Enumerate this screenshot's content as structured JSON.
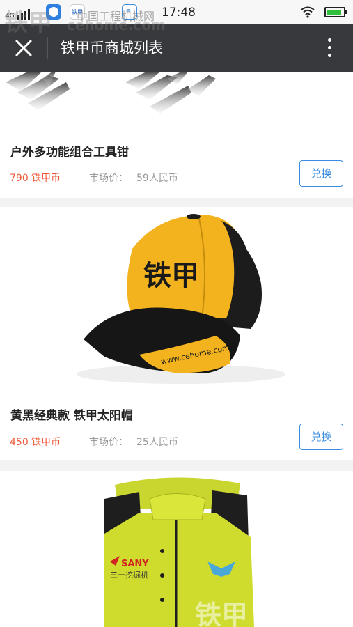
{
  "status_bar": {
    "network": "4G",
    "time": "17:48",
    "app_icon_label": "铁甲"
  },
  "watermark": {
    "brand": "铁甲",
    "site_cn": "中国工程机械网",
    "site": "cehome.com"
  },
  "header": {
    "title": "铁甲币商城列表"
  },
  "products": [
    {
      "name": "户外多功能组合工具钳",
      "price": "790 铁甲币",
      "market_label": "市场价：",
      "market_value": "59人民币",
      "button": "兑换"
    },
    {
      "name": "黄黑经典款 铁甲太阳帽",
      "price": "450 铁甲币",
      "market_label": "市场价：",
      "market_value": "25人民币",
      "button": "兑换",
      "image_text": "铁甲",
      "image_url_text": "www.cehome.com"
    },
    {
      "image_brand": "SANY",
      "image_brand_sub": "三一挖掘机"
    }
  ],
  "colors": {
    "header_bg": "#38393d",
    "price": "#ef5b3a",
    "accent": "#3a8de0",
    "cap_yellow": "#f2b31f"
  }
}
